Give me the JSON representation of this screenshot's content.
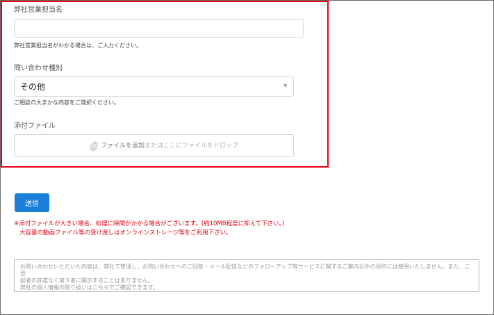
{
  "form": {
    "sales_rep": {
      "label": "弊社営業担当名",
      "value": "",
      "hint": "弊社営業担当名がわかる場合は、ご入力ください。"
    },
    "inquiry_type": {
      "label": "問い合わせ種別",
      "selected": "その他",
      "hint": "ご相談の大まかな内容をご選択ください。"
    },
    "attachment": {
      "label": "添付ファイル",
      "add_text": "ファイルを追加",
      "drop_text": "またはここにファイルをドロップ"
    },
    "submit_label": "送信",
    "warning_line1": "※添付ファイルが大きい場合、処理に時間がかかる場合がございます。(約10MB程度に抑えて下さい。)",
    "warning_line2": "大容量の動画ファイル等の受け渡しはオンラインストレージ等をご利用下さい。",
    "privacy_line1": "お問い合わせいただいた内容は、弊社で管理し、お問い合わせへのご回答・メール配信などのフォローアップ等サービスに関するご案内以外の目的には使用いたしません。また、ご登",
    "privacy_line2": "録者の許諾なく第３者に開示することはありません。",
    "privacy_line3": "弊社の個人情報の取り扱いはこちらでご確認できます。"
  },
  "colors": {
    "highlight": "#e60012",
    "button": "#1a7fd8",
    "warning": "#e60012"
  },
  "icons": {
    "attachment": "paperclip-icon",
    "select": "chevron-down-icon"
  }
}
